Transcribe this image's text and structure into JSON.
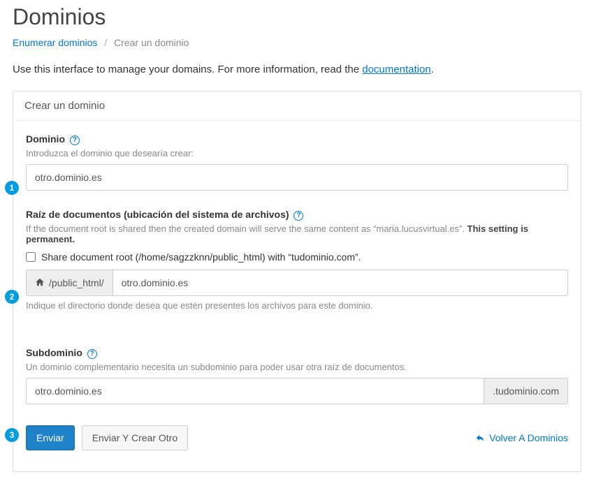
{
  "title": "Dominios",
  "breadcrumb": {
    "list": "Enumerar dominios",
    "current": "Crear un dominio"
  },
  "intro": {
    "pre": "Use this interface to manage your domains. For more information, read the ",
    "link": "documentation",
    "post": "."
  },
  "panel": {
    "heading": "Crear un dominio"
  },
  "domain": {
    "label": "Dominio",
    "hint": "Introduzca el dominio que desearía crear:",
    "value": "otro.dominio.es"
  },
  "docroot": {
    "label": "Raíz de documentos (ubicación del sistema de archivos)",
    "note_pre": "If the document root is shared then the created domain will serve the same content as “maria.lucusvirtual.es”. ",
    "note_bold": "This setting is permanent.",
    "checkbox": "Share document root (/home/sagzzknn/public_html) with “tudominio.com”.",
    "prefix": "/public_html/",
    "value": "otro.dominio.es",
    "below": "Indique el directorio donde desea que estén presentes los archivos para este dominio."
  },
  "subdomain": {
    "label": "Subdominio",
    "hint": "Un dominio complementario necesita un subdominio para poder usar otra raíz de documentos.",
    "value": "otro.dominio.es",
    "suffix": ".tudominio.com"
  },
  "buttons": {
    "submit": "Enviar",
    "another": "Enviar Y Crear Otro",
    "back": "Volver A Dominios"
  },
  "badges": {
    "b1": "1",
    "b2": "2",
    "b3": "3"
  }
}
